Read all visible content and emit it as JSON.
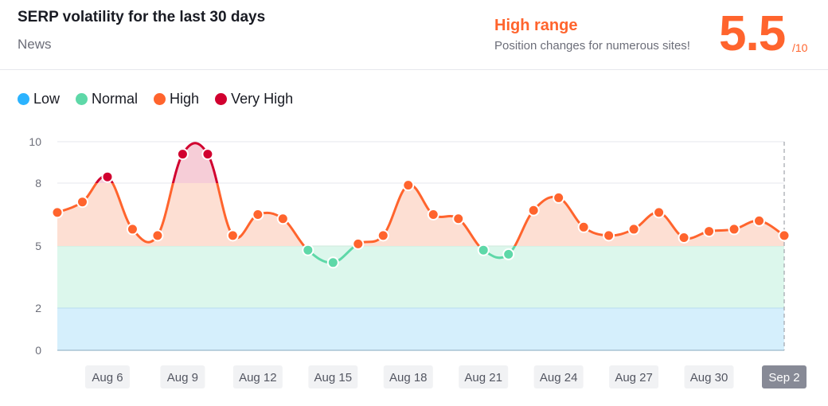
{
  "header": {
    "title": "SERP volatility for the last 30 days",
    "subtitle": "News",
    "range_title": "High range",
    "range_description": "Position changes for numerous sites!",
    "score": "5.5",
    "score_max": "/10"
  },
  "legend": [
    {
      "label": "Low",
      "color": "#2bb3ff"
    },
    {
      "label": "Normal",
      "color": "#5ed8a8"
    },
    {
      "label": "High",
      "color": "#ff642d"
    },
    {
      "label": "Very High",
      "color": "#d1002f"
    }
  ],
  "colors": {
    "low_band": "#d5effc",
    "normal_band": "#dcf7ec",
    "high_band": "#fddfd3",
    "very_high_band": "#f6cdd7",
    "normal_line": "#5ed8a8",
    "high_line": "#ff642d",
    "very_high_line": "#d1002f",
    "grid": "#e6e7ec"
  },
  "chart_data": {
    "type": "line",
    "title": "SERP volatility for the last 30 days",
    "xlabel": "",
    "ylabel": "",
    "ylim": [
      0,
      10
    ],
    "yticks": [
      0,
      2,
      5,
      8,
      10
    ],
    "grid": true,
    "legend_position": "top-left",
    "bands": [
      {
        "name": "Low",
        "range": [
          0,
          2
        ]
      },
      {
        "name": "Normal",
        "range": [
          2,
          5
        ]
      },
      {
        "name": "High",
        "range": [
          5,
          8
        ]
      },
      {
        "name": "Very High",
        "range": [
          8,
          10
        ]
      }
    ],
    "x": [
      "Aug 4",
      "Aug 5",
      "Aug 6",
      "Aug 7",
      "Aug 8",
      "Aug 9",
      "Aug 10",
      "Aug 11",
      "Aug 12",
      "Aug 13",
      "Aug 14",
      "Aug 15",
      "Aug 16",
      "Aug 17",
      "Aug 18",
      "Aug 19",
      "Aug 20",
      "Aug 21",
      "Aug 22",
      "Aug 23",
      "Aug 24",
      "Aug 25",
      "Aug 26",
      "Aug 27",
      "Aug 28",
      "Aug 29",
      "Aug 30",
      "Aug 31",
      "Sep 1",
      "Sep 2"
    ],
    "x_tick_labels": [
      "Aug 6",
      "Aug 9",
      "Aug 12",
      "Aug 15",
      "Aug 18",
      "Aug 21",
      "Aug 24",
      "Aug 27",
      "Aug 30",
      "Sep 2"
    ],
    "selected_x": "Sep 2",
    "series": [
      {
        "name": "Volatility",
        "values": [
          6.6,
          7.1,
          8.3,
          5.8,
          5.5,
          9.4,
          9.4,
          5.5,
          6.5,
          6.3,
          4.8,
          4.2,
          5.1,
          5.5,
          7.9,
          6.5,
          6.3,
          4.8,
          4.6,
          6.7,
          7.3,
          5.9,
          5.5,
          5.8,
          6.6,
          5.4,
          5.7,
          5.8,
          6.2,
          5.5
        ]
      }
    ]
  }
}
